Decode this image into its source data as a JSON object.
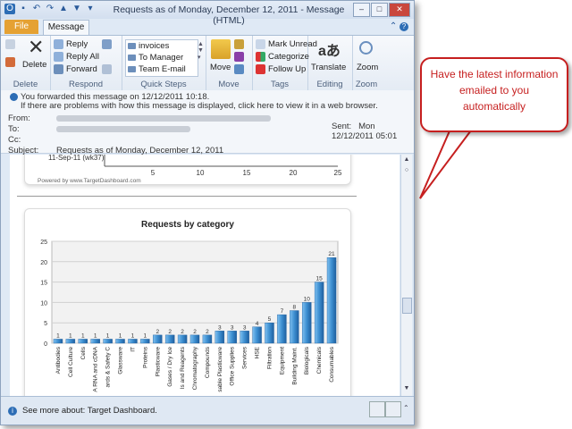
{
  "window": {
    "title": "Requests as of Monday, December 12, 2011  -  Message (HTML)",
    "tabs": [
      "File",
      "Message"
    ]
  },
  "ribbon": {
    "delete_group": {
      "label": "Delete",
      "delete_button": "Delete"
    },
    "respond_group": {
      "label": "Respond",
      "reply": "Reply",
      "reply_all": "Reply All",
      "forward": "Forward"
    },
    "quick_steps_group": {
      "label": "Quick Steps",
      "items": [
        "invoices",
        "To Manager",
        "Team E-mail"
      ]
    },
    "move_group": {
      "label": "Move",
      "move_button": "Move"
    },
    "tags_group": {
      "label": "Tags",
      "mark_unread": "Mark Unread",
      "categorize": "Categorize",
      "follow_up": "Follow Up"
    },
    "editing_group": {
      "label": "Editing",
      "translate": "Translate"
    },
    "zoom_group": {
      "label": "Zoom",
      "zoom_button": "Zoom"
    }
  },
  "header": {
    "info_line1": "You forwarded this message on 12/12/2011 10:18.",
    "info_line2": "If there are problems with how this message is displayed, click here to view it in a web browser.",
    "from_label": "From:",
    "to_label": "To:",
    "cc_label": "Cc:",
    "subject_label": "Subject:",
    "subject": "Requests as of Monday, December 12, 2011",
    "sent_label": "Sent:",
    "sent_value": "Mon 12/12/2011 05:01"
  },
  "top_chart": {
    "row_label": "11-Sep-11 (wk37)",
    "ticks": [
      "5",
      "10",
      "15",
      "20",
      "25"
    ],
    "powered_by": "Powered by www.TargetDashboard.com"
  },
  "people_pane": {
    "see_more": "See more about: Target Dashboard."
  },
  "callout": {
    "text": "Have the latest information emailed to you automatically"
  },
  "chart_data": {
    "type": "bar",
    "title": "Requests by category",
    "categories": [
      "Antibodies",
      "Cell Culture",
      "Cells",
      "A RNA and cDNA",
      "ards & Safety C",
      "Glassware",
      "IT",
      "Proteins",
      "Plasticware",
      "Gases / Dry Ice",
      "ls and Reagents",
      "Chromatography",
      "Compounds",
      "sable Plasticware",
      "Office Supplies",
      "Services",
      "HSE",
      "Filtration",
      "Equipment",
      "Building Maint.",
      "Biologicals",
      "Chemicals",
      "Consumables"
    ],
    "values": [
      1,
      1,
      1,
      1,
      1,
      1,
      1,
      1,
      2,
      2,
      2,
      2,
      2,
      3,
      3,
      3,
      4,
      5,
      7,
      8,
      10,
      15,
      21
    ],
    "ylim": [
      0,
      25
    ],
    "yticks": [
      0,
      5,
      10,
      15,
      20,
      25
    ],
    "grid": true,
    "bar_color": "#3d8fd1"
  }
}
